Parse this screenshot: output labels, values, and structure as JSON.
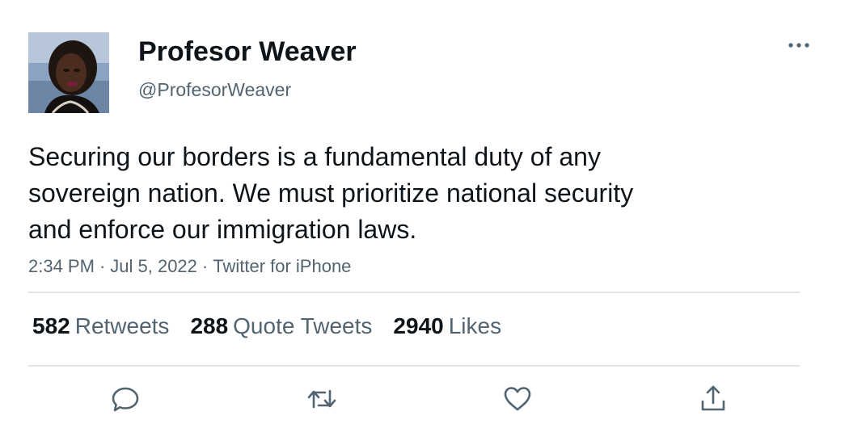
{
  "user": {
    "display_name": "Profesor Weaver",
    "handle": "@ProfesorWeaver",
    "avatar": "profile-photo"
  },
  "tweet": {
    "text_lines": [
      "Securing our borders is a fundamental duty of any",
      "sovereign nation. We must prioritize national security",
      "and enforce our immigration laws."
    ],
    "time": "2:34 PM",
    "date": "Jul 5, 2022",
    "source": "Twitter for iPhone",
    "separator": "·"
  },
  "stats": {
    "retweets": {
      "count": "582",
      "label": "Retweets"
    },
    "quotes": {
      "count": "288",
      "label": "Quote Tweets"
    },
    "likes": {
      "count": "2940",
      "label": "Likes"
    }
  },
  "actions": [
    "reply-icon",
    "retweet-icon",
    "like-icon",
    "share-icon"
  ],
  "colors": {
    "text": "#0f1419",
    "secondary": "#536471",
    "divider": "#e1e5e8"
  }
}
